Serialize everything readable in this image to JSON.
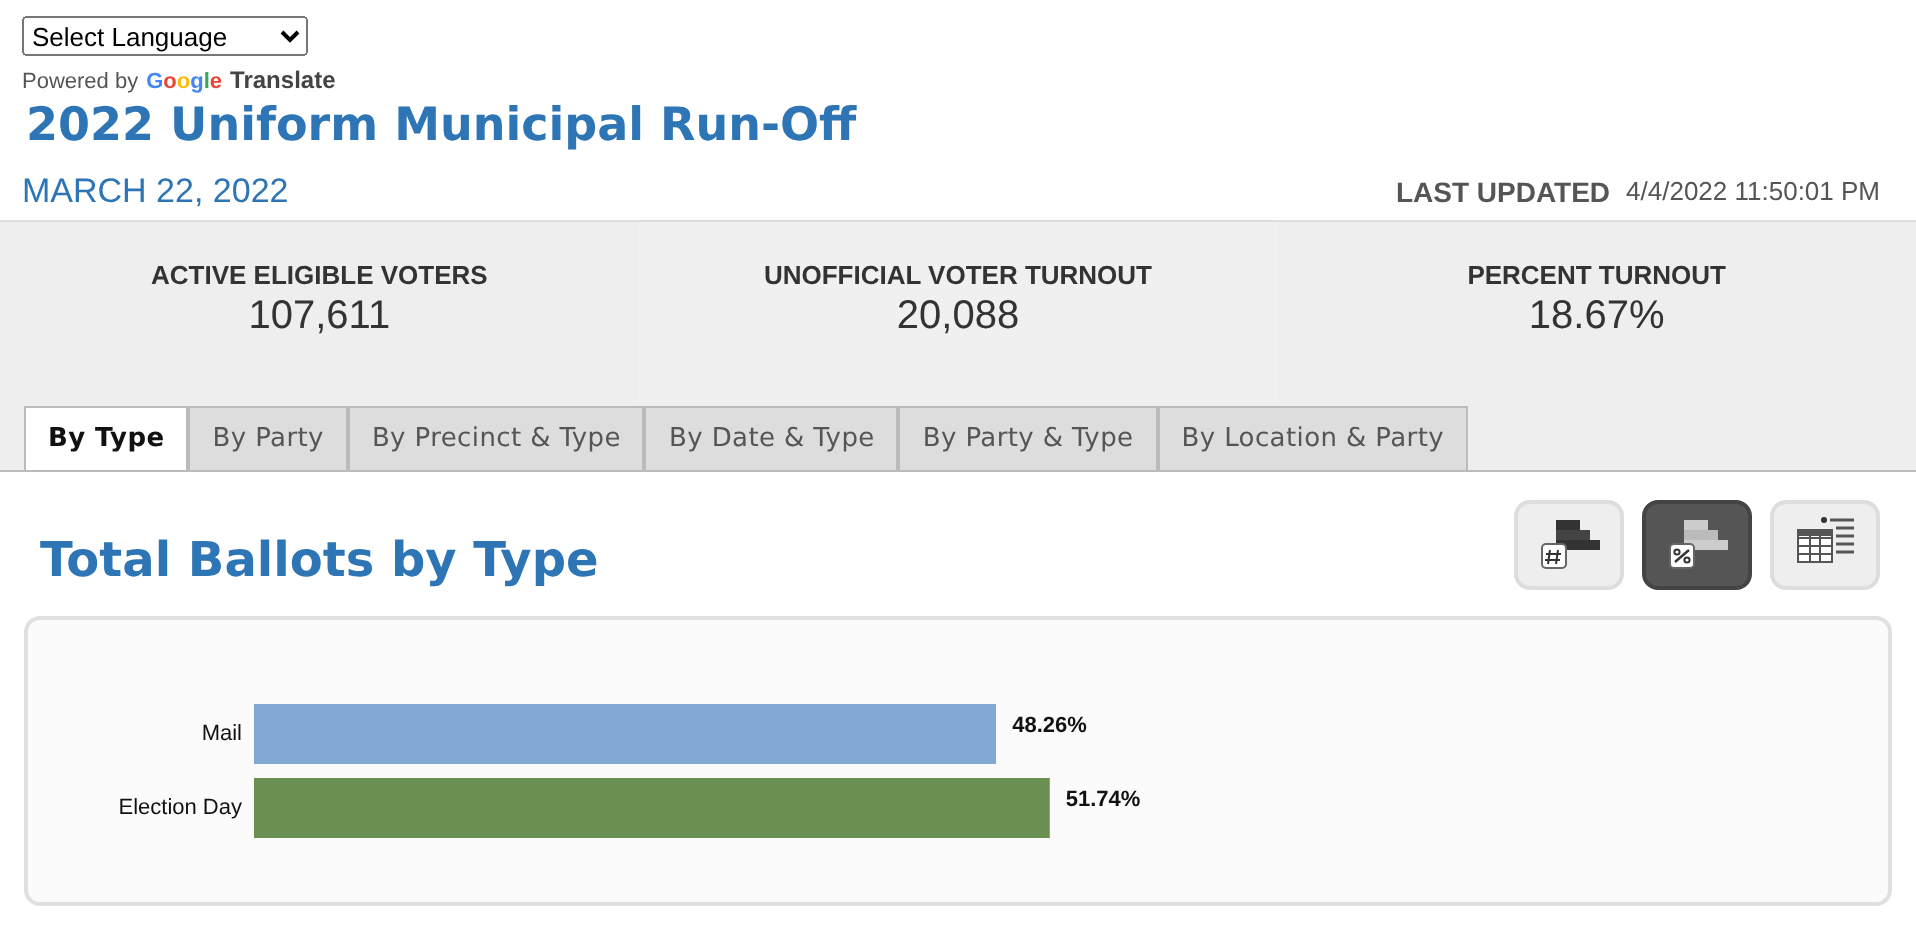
{
  "language_select": {
    "value": "Select Language"
  },
  "translate_credit": {
    "prefix": "Powered by",
    "brand": "Google",
    "suffix": "Translate"
  },
  "title": "2022 Uniform Municipal Run-Off",
  "date": "MARCH 22, 2022",
  "last_updated": {
    "label": "LAST UPDATED",
    "value": "4/4/2022 11:50:01 PM"
  },
  "stats": [
    {
      "label": "ACTIVE ELIGIBLE VOTERS",
      "value": "107,611"
    },
    {
      "label": "UNOFFICIAL VOTER TURNOUT",
      "value": "20,088"
    },
    {
      "label": "PERCENT TURNOUT",
      "value": "18.67%"
    }
  ],
  "tabs": [
    {
      "label": "By Type",
      "selected": true
    },
    {
      "label": "By Party",
      "selected": false
    },
    {
      "label": "By Precinct & Type",
      "selected": false
    },
    {
      "label": "By Date & Type",
      "selected": false
    },
    {
      "label": "By Party & Type",
      "selected": false
    },
    {
      "label": "By Location & Party",
      "selected": false
    }
  ],
  "section_title": "Total Ballots by Type",
  "view_buttons": [
    {
      "kind": "count",
      "selected": false
    },
    {
      "kind": "percent",
      "selected": true
    },
    {
      "kind": "table",
      "selected": false
    }
  ],
  "chart": {
    "bars": [
      {
        "color": "#82a8d4"
      },
      {
        "color": "#6a8f51"
      }
    ],
    "chart_data": {
      "type": "bar",
      "orientation": "horizontal",
      "categories": [
        "Mail",
        "Election Day"
      ],
      "values": [
        48.26,
        51.74
      ],
      "value_labels": [
        "48.26%",
        "51.74%"
      ]
    }
  }
}
